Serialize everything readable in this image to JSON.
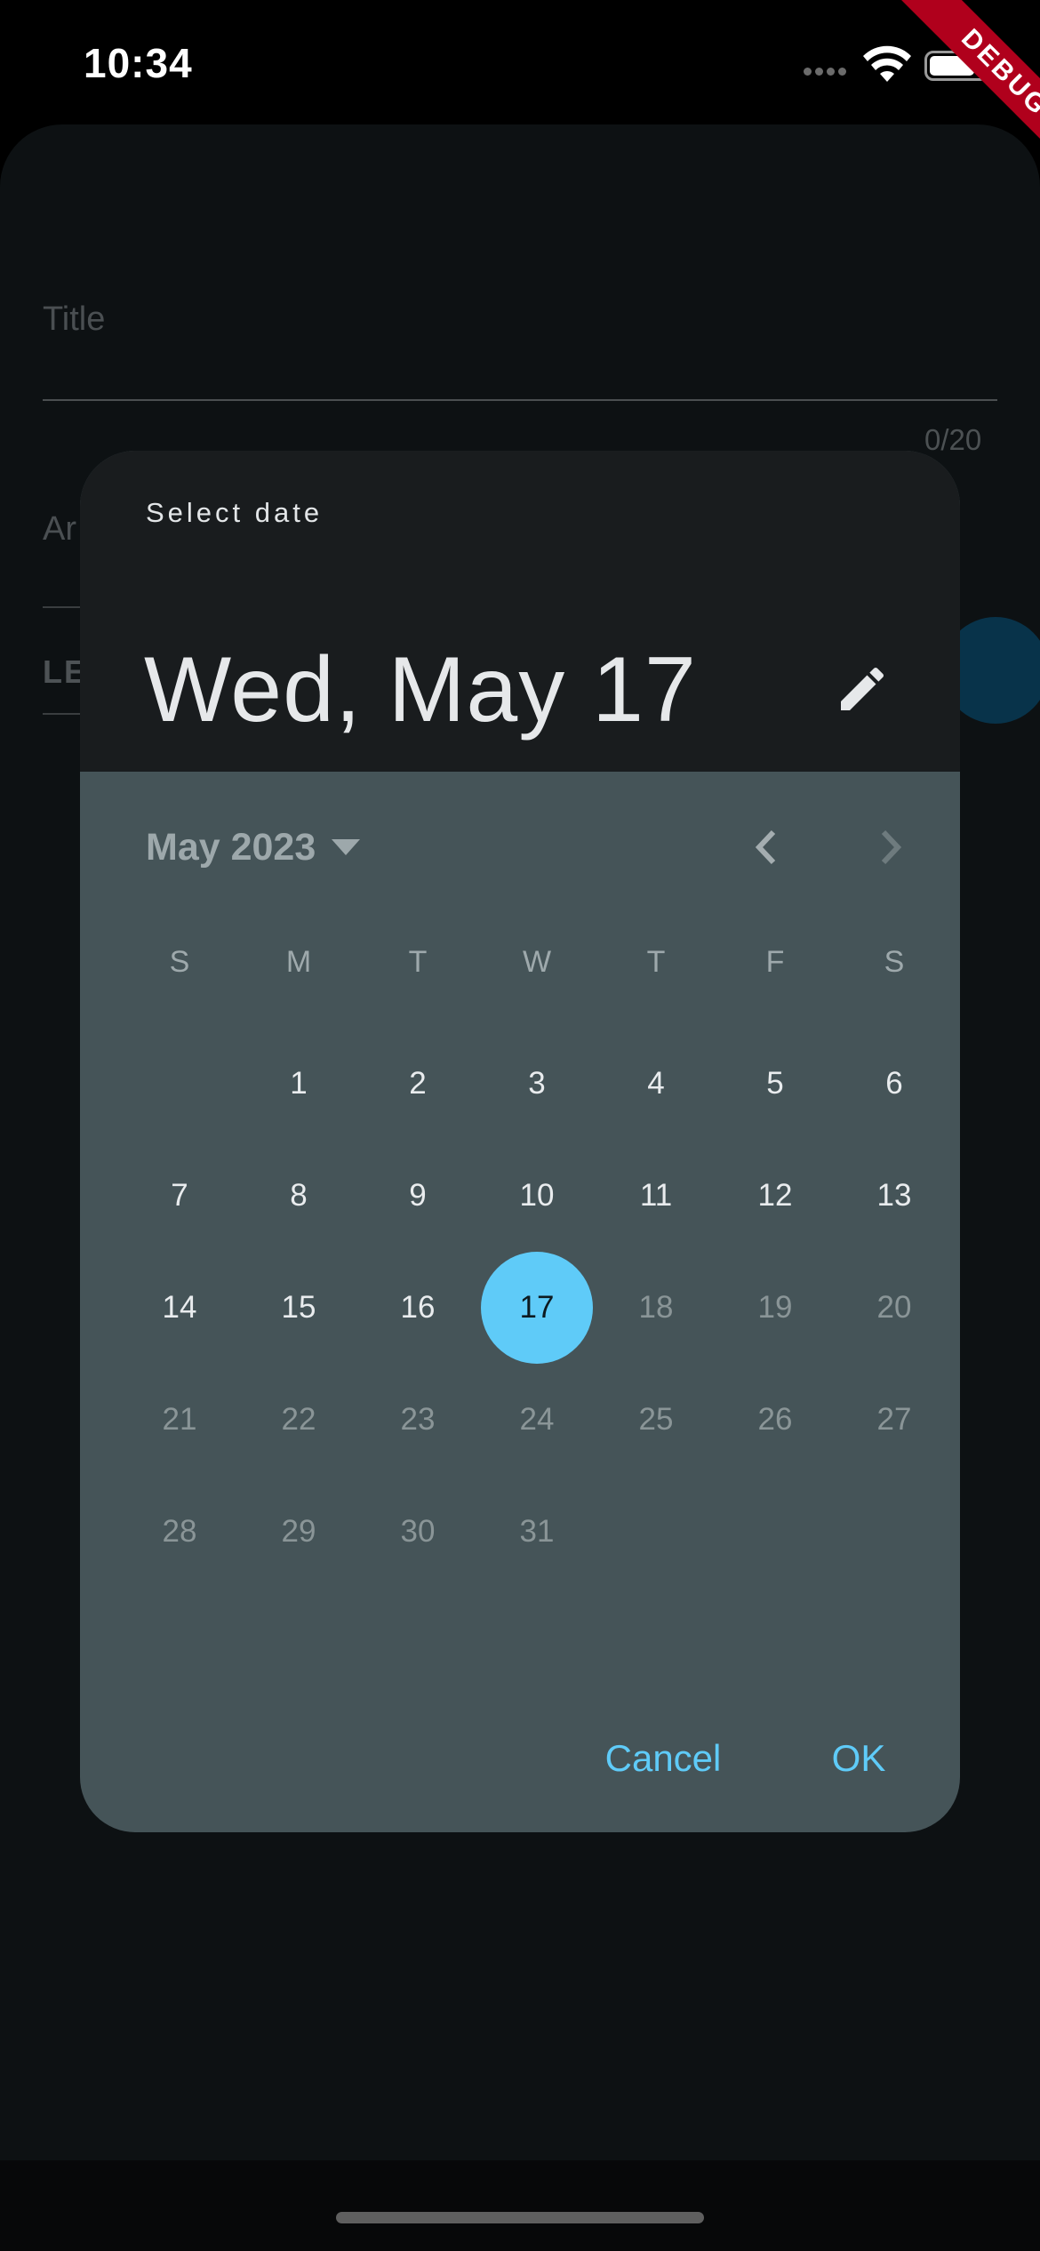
{
  "status_bar": {
    "time": "10:34"
  },
  "debug_banner": "DEBUG",
  "background_form": {
    "title_label": "Title",
    "title_counter": "0/20",
    "amount_label_partial": "Ar",
    "lead_text_partial": "LE"
  },
  "date_picker": {
    "header_label": "Select date",
    "selected_date": "Wed, May 17",
    "month_year": "May 2023",
    "weekdays": [
      "S",
      "M",
      "T",
      "W",
      "T",
      "F",
      "S"
    ],
    "weeks": [
      [
        "",
        "1",
        "2",
        "3",
        "4",
        "5",
        "6"
      ],
      [
        "7",
        "8",
        "9",
        "10",
        "11",
        "12",
        "13"
      ],
      [
        "14",
        "15",
        "16",
        "17",
        "18",
        "19",
        "20"
      ],
      [
        "21",
        "22",
        "23",
        "24",
        "25",
        "26",
        "27"
      ],
      [
        "28",
        "29",
        "30",
        "31",
        "",
        "",
        ""
      ]
    ],
    "selected_day": "17",
    "last_enabled_day": 17,
    "cancel_label": "Cancel",
    "ok_label": "OK"
  },
  "colors": {
    "accent": "#5fcbf8",
    "dialog_body": "#455458",
    "dialog_header": "#191c1e",
    "app_background": "#0d1113",
    "debug_ribbon": "#b0001c"
  }
}
